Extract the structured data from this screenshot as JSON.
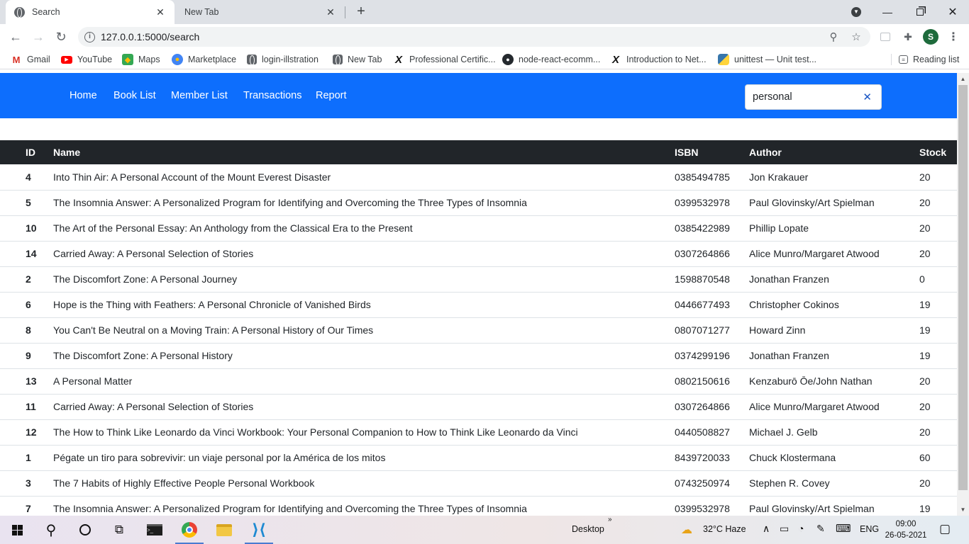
{
  "browser": {
    "tabs": [
      {
        "title": "Search",
        "active": true
      },
      {
        "title": "New Tab",
        "active": false
      }
    ],
    "url": "127.0.0.1:5000/search",
    "profile_initial": "S",
    "bookmarks": [
      {
        "label": "Gmail",
        "icon": "gmail-icon"
      },
      {
        "label": "YouTube",
        "icon": "youtube-icon"
      },
      {
        "label": "Maps",
        "icon": "maps-icon"
      },
      {
        "label": "Marketplace",
        "icon": "marketplace-icon"
      },
      {
        "label": "login-illstration",
        "icon": "globe-icon"
      },
      {
        "label": "New Tab",
        "icon": "globe-icon"
      },
      {
        "label": "Professional Certific...",
        "icon": "x-logo-icon"
      },
      {
        "label": "node-react-ecomm...",
        "icon": "github-icon"
      },
      {
        "label": "Introduction to Net...",
        "icon": "x-logo-icon"
      },
      {
        "label": "unittest — Unit test...",
        "icon": "python-icon"
      }
    ],
    "reading_list": "Reading list"
  },
  "nav": {
    "links": [
      "Home",
      "Book List",
      "Member List",
      "Transactions",
      "Report"
    ],
    "search_value": "personal"
  },
  "table": {
    "columns": [
      "ID",
      "Name",
      "ISBN",
      "Author",
      "Stock"
    ],
    "rows": [
      [
        "4",
        "Into Thin Air: A Personal Account of the Mount Everest Disaster",
        "0385494785",
        "Jon Krakauer",
        "20"
      ],
      [
        "5",
        "The Insomnia Answer: A Personalized Program for Identifying and Overcoming the Three Types of Insomnia",
        "0399532978",
        "Paul Glovinsky/Art Spielman",
        "20"
      ],
      [
        "10",
        "The Art of the Personal Essay: An Anthology from the Classical Era to the Present",
        "0385422989",
        "Phillip Lopate",
        "20"
      ],
      [
        "14",
        "Carried Away: A Personal Selection of Stories",
        "0307264866",
        "Alice Munro/Margaret Atwood",
        "20"
      ],
      [
        "2",
        "The Discomfort Zone: A Personal Journey",
        "1598870548",
        "Jonathan Franzen",
        "0"
      ],
      [
        "6",
        "Hope is the Thing with Feathers: A Personal Chronicle of Vanished Birds",
        "0446677493",
        "Christopher Cokinos",
        "19"
      ],
      [
        "8",
        "You Can't Be Neutral on a Moving Train: A Personal History of Our Times",
        "0807071277",
        "Howard Zinn",
        "19"
      ],
      [
        "9",
        "The Discomfort Zone: A Personal History",
        "0374299196",
        "Jonathan Franzen",
        "19"
      ],
      [
        "13",
        "A Personal Matter",
        "0802150616",
        "Kenzaburō Ōe/John Nathan",
        "20"
      ],
      [
        "11",
        "Carried Away: A Personal Selection of Stories",
        "0307264866",
        "Alice Munro/Margaret Atwood",
        "20"
      ],
      [
        "12",
        "The How to Think Like Leonardo da Vinci Workbook: Your Personal Companion to How to Think Like Leonardo da Vinci",
        "0440508827",
        "Michael J. Gelb",
        "20"
      ],
      [
        "1",
        "Pégate un tiro para sobrevivir: un viaje personal por la América de los mitos",
        "8439720033",
        "Chuck Klostermana",
        "60"
      ],
      [
        "3",
        "The 7 Habits of Highly Effective People Personal Workbook",
        "0743250974",
        "Stephen R. Covey",
        "20"
      ],
      [
        "7",
        "The Insomnia Answer: A Personalized Program for Identifying and Overcoming the Three Types of Insomnia",
        "0399532978",
        "Paul Glovinsky/Art Spielman",
        "19"
      ]
    ]
  },
  "taskbar": {
    "desktop_label": "Desktop",
    "weather": "32°C  Haze",
    "language": "ENG",
    "time": "09:00",
    "date": "26-05-2021"
  },
  "colors": {
    "navbar": "#0d6efd",
    "table_header": "#212529"
  }
}
